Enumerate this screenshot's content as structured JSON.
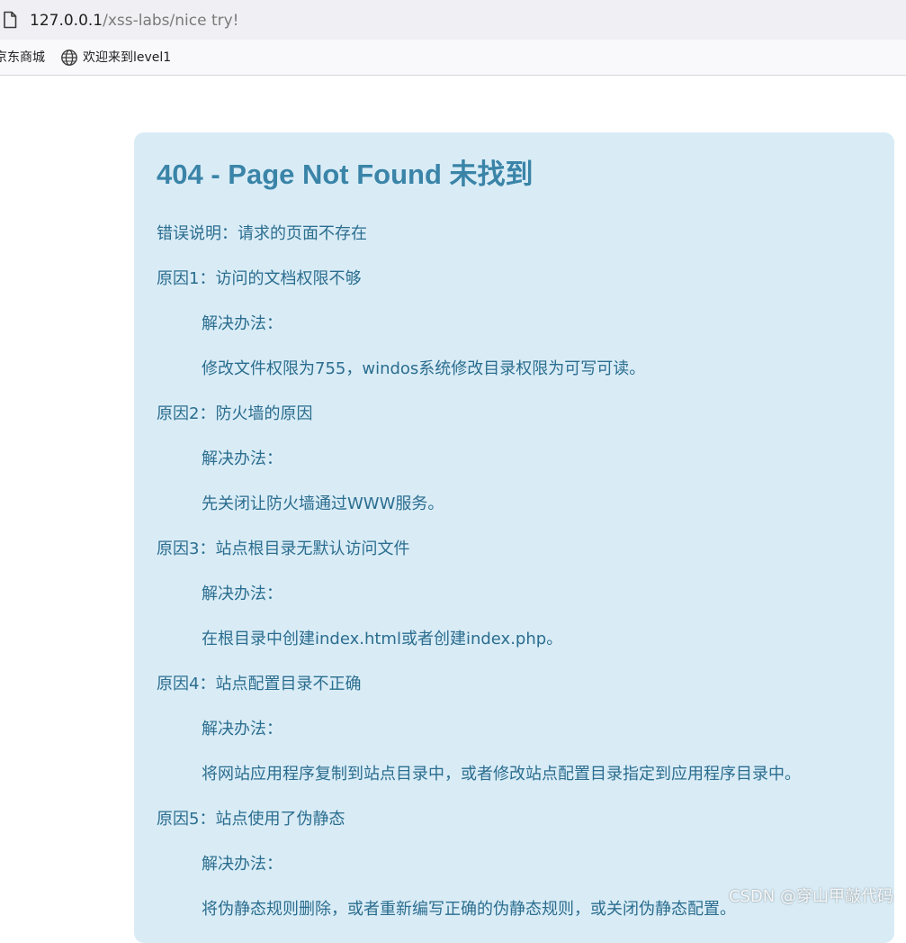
{
  "browser": {
    "url_host": "127.0.0.1",
    "url_path": "/xss-labs/nice try!",
    "bookmarks": [
      {
        "label": "京东商城"
      },
      {
        "label": "欢迎来到level1"
      }
    ]
  },
  "page": {
    "title": "404 - Page Not Found 未找到",
    "lines": [
      "错误说明：请求的页面不存在",
      "原因1：访问的文档权限不够",
      "解决办法：",
      "修改文件权限为755，windos系统修改目录权限为可写可读。",
      "原因2：防火墙的原因",
      "解决办法：",
      "先关闭让防火墙通过WWW服务。",
      "原因3：站点根目录无默认访问文件",
      "解决办法：",
      "在根目录中创建index.html或者创建index.php。",
      "原因4：站点配置目录不正确",
      "解决办法：",
      "将网站应用程序复制到站点目录中，或者修改站点配置目录指定到应用程序目录中。",
      "原因5：站点使用了伪静态",
      "解决办法：",
      "将伪静态规则删除，或者重新编写正确的伪静态规则，或关闭伪静态配置。"
    ]
  },
  "watermark": "CSDN @穿山甲敲代码",
  "colors": {
    "title": "#3a84a8",
    "text": "#2b6d8f",
    "box_background": "#d9ecf6"
  },
  "icons": {
    "page": "page-icon",
    "bookmark": "globe-icon"
  }
}
